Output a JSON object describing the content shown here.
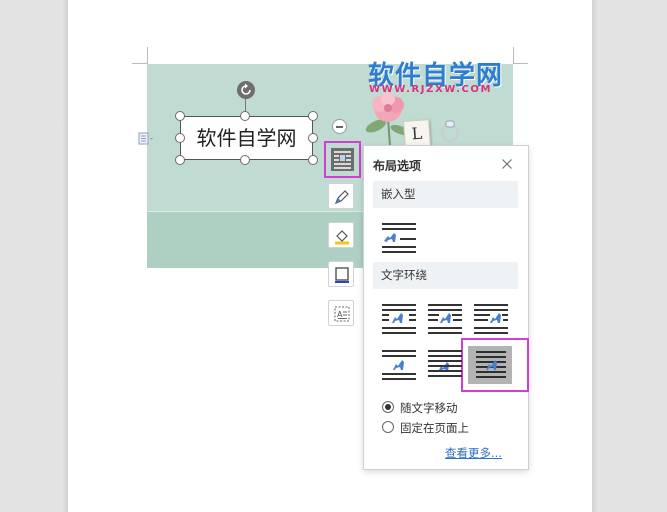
{
  "document": {
    "watermark_title": "软件自学网",
    "watermark_url": "WWW.RJZXW.COM",
    "tile_letter": "L",
    "textbox_text": "软件自学网"
  },
  "floating_toolbar": {
    "items": [
      {
        "name": "layout-options",
        "icon": "wrap-layout-icon",
        "active": true
      },
      {
        "name": "shape-outline",
        "icon": "pen-icon"
      },
      {
        "name": "shape-fill",
        "icon": "fill-bucket-icon"
      },
      {
        "name": "shape-frame",
        "icon": "frame-icon"
      },
      {
        "name": "text-box-options",
        "icon": "text-frame-icon"
      }
    ]
  },
  "layout_panel": {
    "title": "布局选项",
    "close_icon": "close-icon",
    "inline_section": "嵌入型",
    "wrap_section": "文字环绕",
    "wrap_options_selected_index": 5,
    "radio_move_with_text": "随文字移动",
    "radio_fixed_position": "固定在页面上",
    "radio_selected": "move_with_text",
    "see_more": "查看更多..."
  },
  "colors": {
    "highlight": "#d23ecf",
    "link": "#2f6fc0",
    "banner": "#c0dcd2",
    "watermark_blue": "#2d7dd2",
    "watermark_pink": "#d6337e",
    "icon_blue": "#4a7fcb"
  }
}
